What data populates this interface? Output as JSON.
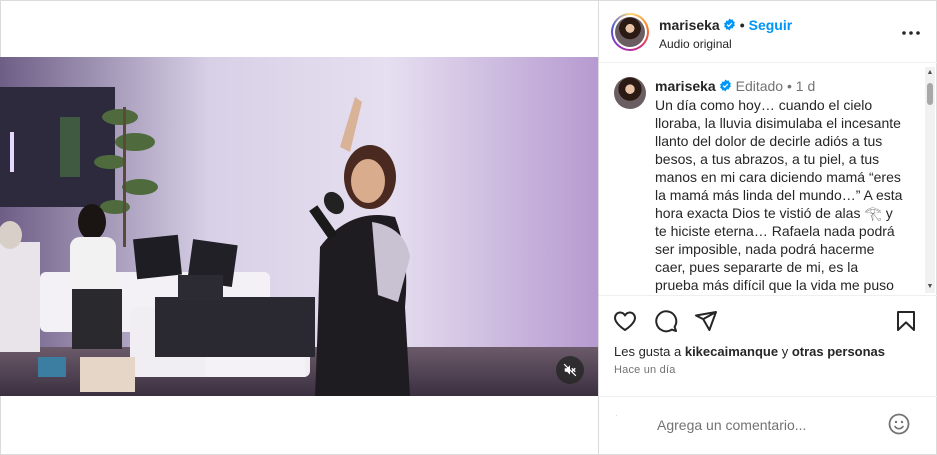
{
  "header": {
    "username": "mariseka",
    "separator": "•",
    "follow_label": "Seguir",
    "subtitle": "Audio original"
  },
  "caption": {
    "username": "mariseka",
    "edited": "Editado",
    "separator": "•",
    "age": "1 d",
    "text": "Un día como hoy… cuando el cielo lloraba, la lluvia disimulaba el incesante llanto del dolor de decirle adiós a tus besos, a tus abrazos, a tu piel, a tus manos en mi cara diciendo mamá “eres la mamá más linda del mundo…” A esta hora exacta Dios te vistió de alas 𓂀 y te hiciste eterna… Rafaela nada podrá ser imposible, nada podrá hacerme caer, pues separarte de mi, es la prueba más difícil que la vida me puso en frente,"
  },
  "likes": {
    "prefix": "Les gusta a",
    "user": "kikecaimanque",
    "connector": "y",
    "others": "otras personas"
  },
  "timestamp": "Hace un día",
  "comment": {
    "placeholder": "Agrega un comentario..."
  },
  "icons": {
    "verified": "verified-badge-icon",
    "more": "more-options-icon",
    "like": "heart-icon",
    "comment": "comment-icon",
    "share": "share-icon",
    "save": "bookmark-icon",
    "emoji": "emoji-icon",
    "mute": "speaker-muted-icon"
  },
  "colors": {
    "accent": "#0095f6",
    "verified": "#0095f6",
    "text": "#262626",
    "secondary_text": "#737373"
  }
}
